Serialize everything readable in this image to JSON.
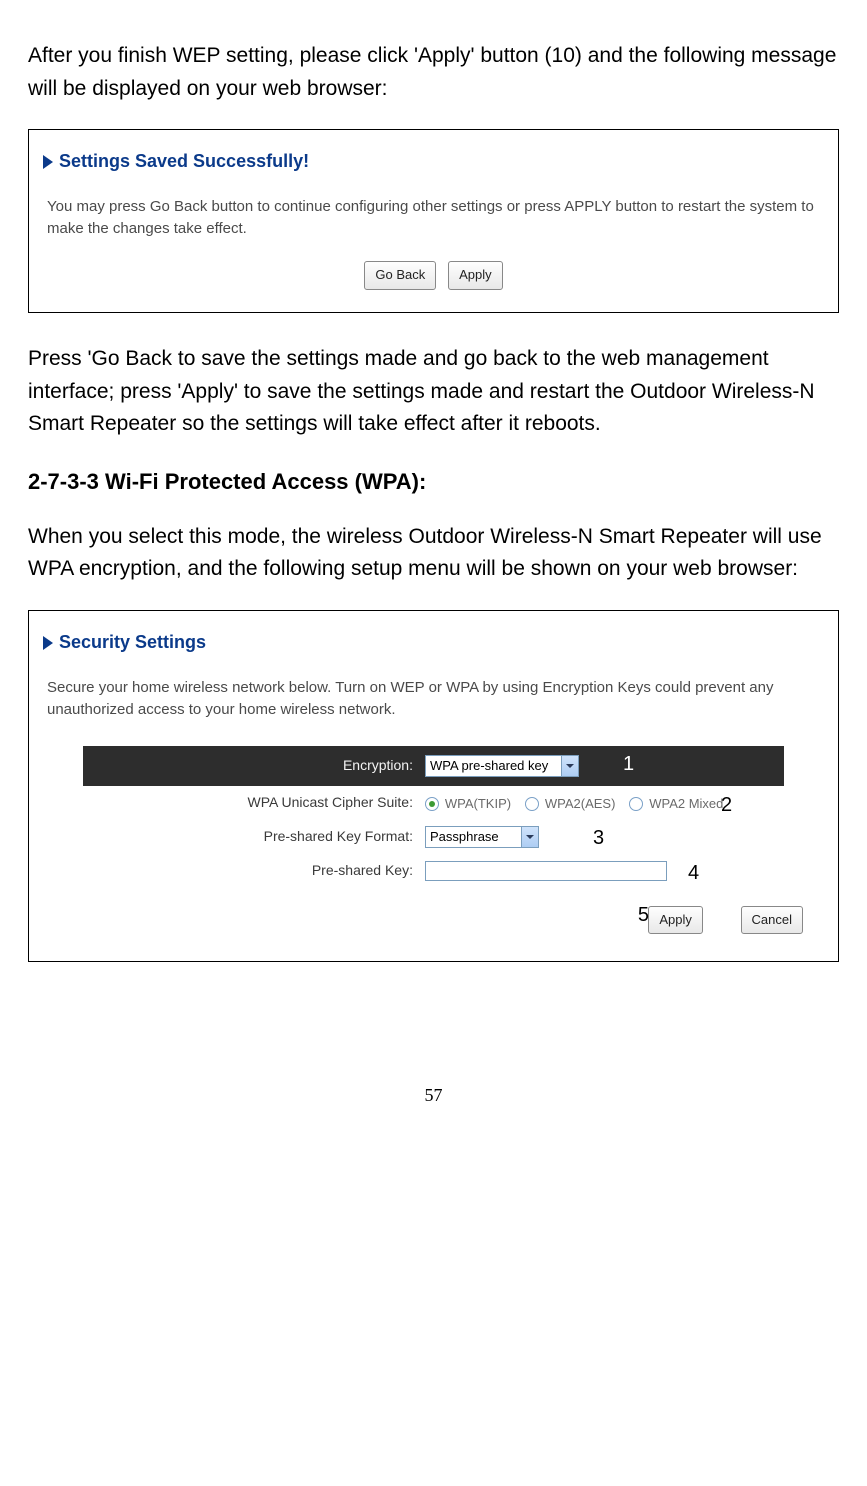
{
  "intro_p1": "After you finish WEP setting, please click 'Apply' button (10) and the following message will be displayed on your web browser:",
  "box1": {
    "title": "Settings Saved Successfully!",
    "text": "You may press Go Back button to continue configuring other settings or press APPLY button to restart the system to make the changes take effect.",
    "goback": "Go Back",
    "apply": "Apply"
  },
  "mid_p": "Press 'Go Back to save the settings made and go back to the web management interface; press 'Apply' to save the settings made and restart the Outdoor Wireless-N Smart Repeater so the settings will take effect after it reboots.",
  "heading": "2-7-3-3 Wi-Fi Protected Access (WPA):",
  "p2": "When you select this mode, the wireless Outdoor Wireless-N Smart Repeater will use WPA encryption, and the following setup menu will be shown on your web browser:",
  "box2": {
    "title": "Security Settings",
    "text": "Secure your home wireless network below. Turn on WEP or WPA by using Encryption Keys could prevent any unauthorized access to your home wireless network.",
    "encryption_label": "Encryption:",
    "encryption_value": "WPA pre-shared key",
    "cipher_label": "WPA Unicast Cipher Suite:",
    "cipher_tkip": "WPA(TKIP)",
    "cipher_aes": "WPA2(AES)",
    "cipher_mixed": "WPA2 Mixed",
    "format_label": "Pre-shared Key Format:",
    "format_value": "Passphrase",
    "key_label": "Pre-shared Key:",
    "apply": "Apply",
    "cancel": "Cancel"
  },
  "callouts": {
    "c1": "1",
    "c2": "2",
    "c3": "3",
    "c4": "4",
    "c5": "5"
  },
  "page_number": "57"
}
